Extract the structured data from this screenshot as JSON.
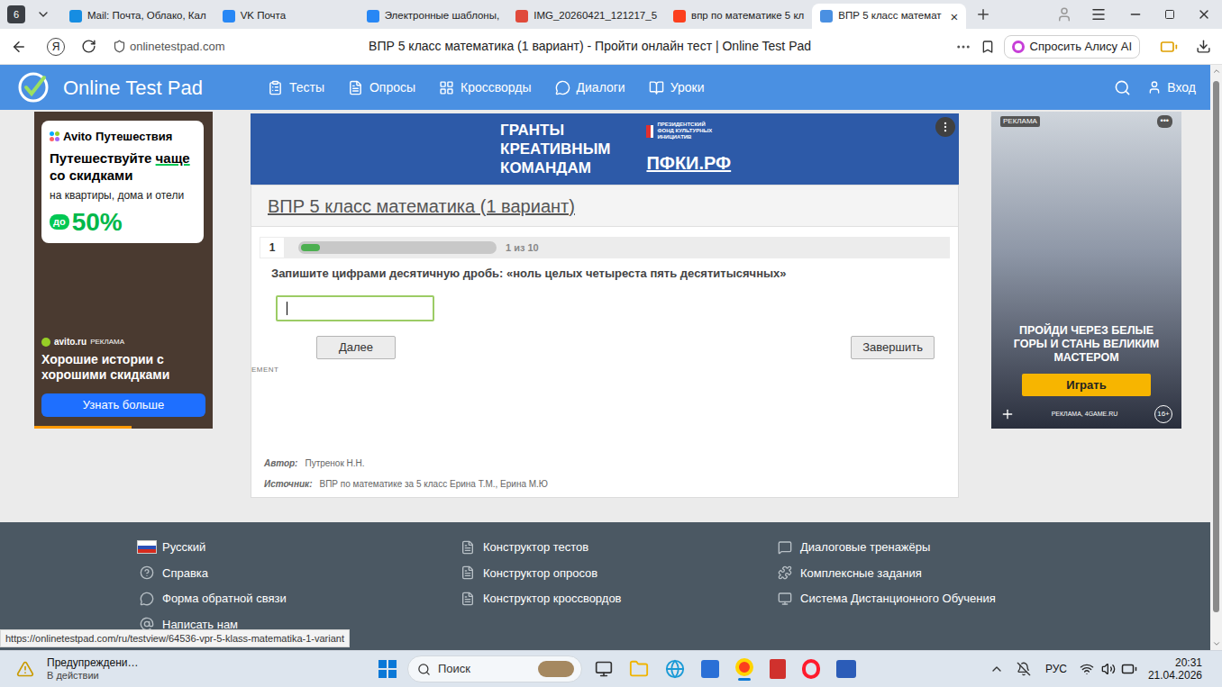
{
  "browser": {
    "tab_count": "6",
    "tabs": [
      {
        "label": "Mail: Почта, Облако, Кал",
        "selected": false
      },
      {
        "label": "VK Почта",
        "selected": false
      },
      {
        "label": "Электронные шаблоны,",
        "selected": false
      },
      {
        "label": "IMG_20260421_121217_5",
        "selected": false
      },
      {
        "label": "впр по математике 5 кл",
        "selected": false
      },
      {
        "label": "ВПР 5 класс математ",
        "selected": true
      }
    ],
    "close_tab": "×",
    "yandex_button": "Я",
    "address": "onlinetestpad.com",
    "page_title": "ВПР 5 класс математика (1 вариант) - Пройти онлайн тест | Online Test Pad",
    "alice_button": "Спросить Алису AI"
  },
  "site": {
    "logo": "Online Test Pad",
    "nav": [
      "Тесты",
      "Опросы",
      "Кроссворды",
      "Диалоги",
      "Уроки"
    ],
    "login": "Вход"
  },
  "left_ad": {
    "brand": "Avito",
    "brand_suffix": "Путешествия",
    "headline_start": "Путешествуйте",
    "headline_accent": "чаще",
    "headline_end": "со скидками",
    "subline": "на квартиры, дома и отели",
    "discount_prefix": "до",
    "discount": "50%",
    "domain": "avito.ru",
    "ad_label": "РЕКЛАМА",
    "slogan": "Хорошие истории с хорошими скидками",
    "button": "Узнать больше"
  },
  "banner": {
    "lines": [
      "ГРАНТЫ",
      "КРЕАТИВНЫМ",
      "КОМАНДАМ"
    ],
    "fund": [
      "ПРЕЗИДЕНТСКИЙ",
      "ФОНД КУЛЬТУРНЫХ",
      "ИНИЦИАТИВ"
    ],
    "site": "ПФКИ.РФ"
  },
  "test": {
    "title": "ВПР 5 класс математика (1 вариант)",
    "question_number": "1",
    "progress": {
      "level": 0.1,
      "reading": "1 из 10"
    },
    "question": "Запишите цифрами десятичную дробь: «ноль целых четыреста пять десятитысячных»",
    "field_focused": true,
    "buttons": {
      "next": "Далее",
      "finish": "Завершить"
    },
    "cut_label": "EMENT",
    "author_label": "Автор:",
    "author": "Путренок Н.Н.",
    "source_label": "Источник:",
    "source": "ВПР по математике за 5 класс Ерина Т.М., Ерина М.Ю"
  },
  "right_ad": {
    "badge": "РЕКЛАМА",
    "menu": "•••",
    "headline": "ПРОЙДИ ЧЕРЕЗ БЕЛЫЕ ГОРЫ И СТАНЬ ВЕЛИКИМ МАСТЕРОМ",
    "button": "Играть",
    "footer": "РЕКЛАМА, 4GAME.RU",
    "age": "16+"
  },
  "footer": {
    "columns": [
      [
        "Русский",
        "Справка",
        "Форма обратной связи",
        "Написать нам"
      ],
      [
        "Конструктор тестов",
        "Конструктор опросов",
        "Конструктор кроссвордов"
      ],
      [
        "Диалоговые тренажёры",
        "Комплексные задания",
        "Система Дистанционного Обучения"
      ]
    ]
  },
  "status_url": "https://onlinetestpad.com/ru/testview/64536-vpr-5-klass-matematika-1-variant",
  "taskbar": {
    "notification": {
      "title": "Предупреждени…",
      "subtitle": "В действии"
    },
    "search": "Поиск",
    "language": "РУС",
    "time": "20:31",
    "date": "21.04.2026"
  }
}
